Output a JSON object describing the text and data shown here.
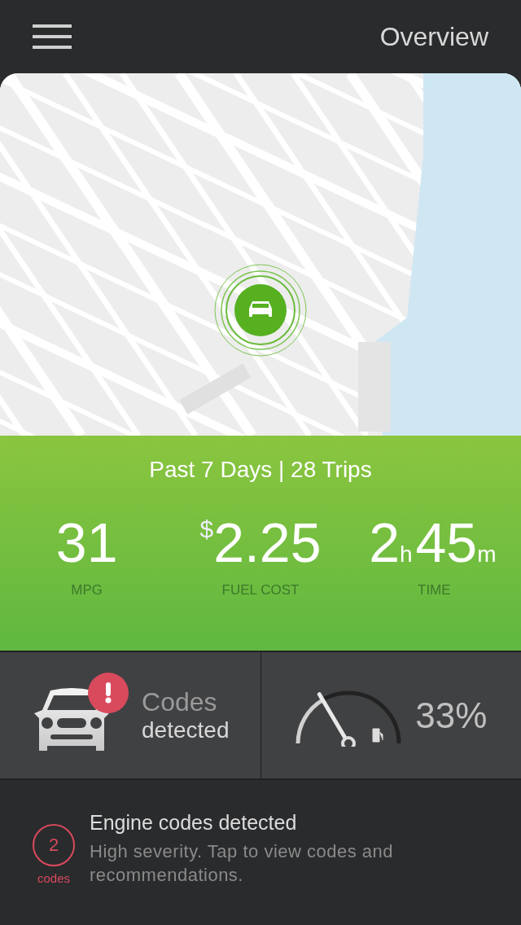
{
  "header": {
    "title": "Overview"
  },
  "summary": {
    "period": "Past 7 Days | 28 Trips",
    "stats": [
      {
        "label": "MPG",
        "parts": [
          {
            "kind": "number",
            "text": "31"
          }
        ]
      },
      {
        "label": "FUEL COST",
        "parts": [
          {
            "kind": "prefix",
            "text": "$"
          },
          {
            "kind": "number",
            "text": "2.25"
          }
        ]
      },
      {
        "label": "TIME",
        "parts": [
          {
            "kind": "number",
            "text": "2"
          },
          {
            "kind": "unit",
            "text": "h"
          },
          {
            "kind": "number",
            "text": "45"
          },
          {
            "kind": "unit",
            "text": "m"
          }
        ]
      }
    ]
  },
  "codes_tile": {
    "alert": true,
    "line_1": "Codes",
    "line_2": "detected"
  },
  "fuel_tile": {
    "level": 0.33,
    "reading": "33%"
  },
  "alert": {
    "count": "2",
    "count_label": "codes",
    "title": "Engine codes detected",
    "description": "High severity. Tap to view codes and recommendations."
  }
}
